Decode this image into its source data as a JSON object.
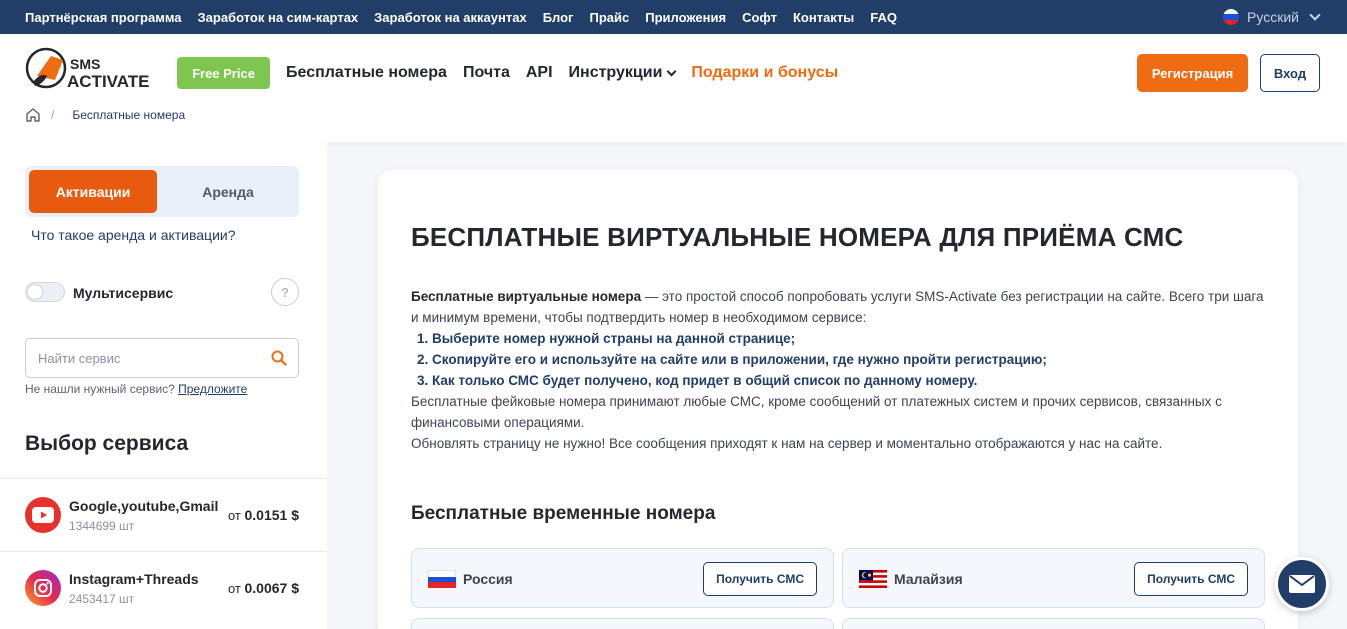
{
  "topbar": {
    "links": [
      "Партнёрская программа",
      "Заработок на сим-картах",
      "Заработок на аккаунтах",
      "Блог",
      "Прайс",
      "Приложения",
      "Софт",
      "Контакты",
      "FAQ"
    ],
    "language": "Русский"
  },
  "header": {
    "free_price": "Free Price",
    "nav": {
      "free_numbers": "Бесплатные номера",
      "mail": "Почта",
      "api": "API",
      "instructions": "Инструкции",
      "gifts": "Подарки и бонусы"
    },
    "register": "Регистрация",
    "login": "Вход"
  },
  "breadcrumb": {
    "current": "Бесплатные номера",
    "separator": "/"
  },
  "sidebar": {
    "tab_activations": "Активации",
    "tab_rent": "Аренда",
    "what_is_link": "Что такое аренда и активации?",
    "multiservice": "Мультисервис",
    "help": "?",
    "search_placeholder": "Найти сервис",
    "not_found": "Не нашли нужный сервис?",
    "suggest": "Предложите",
    "select_title": "Выбор сервиса",
    "services": [
      {
        "name": "Google,youtube,Gmail",
        "count": "1344699 шт",
        "price_prefix": "от",
        "price": "0.0151 $",
        "icon": "youtube-icon"
      },
      {
        "name": "Instagram+Threads",
        "count": "2453417 шт",
        "price_prefix": "от",
        "price": "0.0067 $",
        "icon": "instagram-icon"
      }
    ]
  },
  "main": {
    "title": "БЕСПЛАТНЫЕ ВИРТУАЛЬНЫЕ НОМЕРА ДЛЯ ПРИЁМА СМС",
    "intro_bold": "Бесплатные виртуальные номера",
    "intro_rest": " — это простой способ попробовать услуги SMS-Activate без регистрации на сайте. Всего три шага и минимум времени, чтобы подтвердить номер в необходимом сервисе:",
    "steps": [
      "1.  Выберите номер нужной страны на данной странице;",
      "2.  Скопируйте его и используйте на сайте или в приложении, где нужно пройти регистрацию;",
      "3.  Как только СМС будет получено, код придет в общий список по данному номеру."
    ],
    "note1": "Бесплатные фейковые номера принимают любые СМС, кроме сообщений от платежных систем и прочих сервисов, связанных с финансовыми операциями.",
    "note2": "Обновлять страницу не нужно! Все сообщения приходят к нам на сервер и моментально отображаются у нас на сайте.",
    "subtitle": "Бесплатные временные номера",
    "numbers": [
      {
        "country": "Россия",
        "button": "Получить СМС"
      },
      {
        "country": "Малайзия",
        "button": "Получить СМС"
      }
    ]
  },
  "colors": {
    "navy": "#213e68",
    "orange": "#ef6c12",
    "green": "#7ec64f"
  }
}
